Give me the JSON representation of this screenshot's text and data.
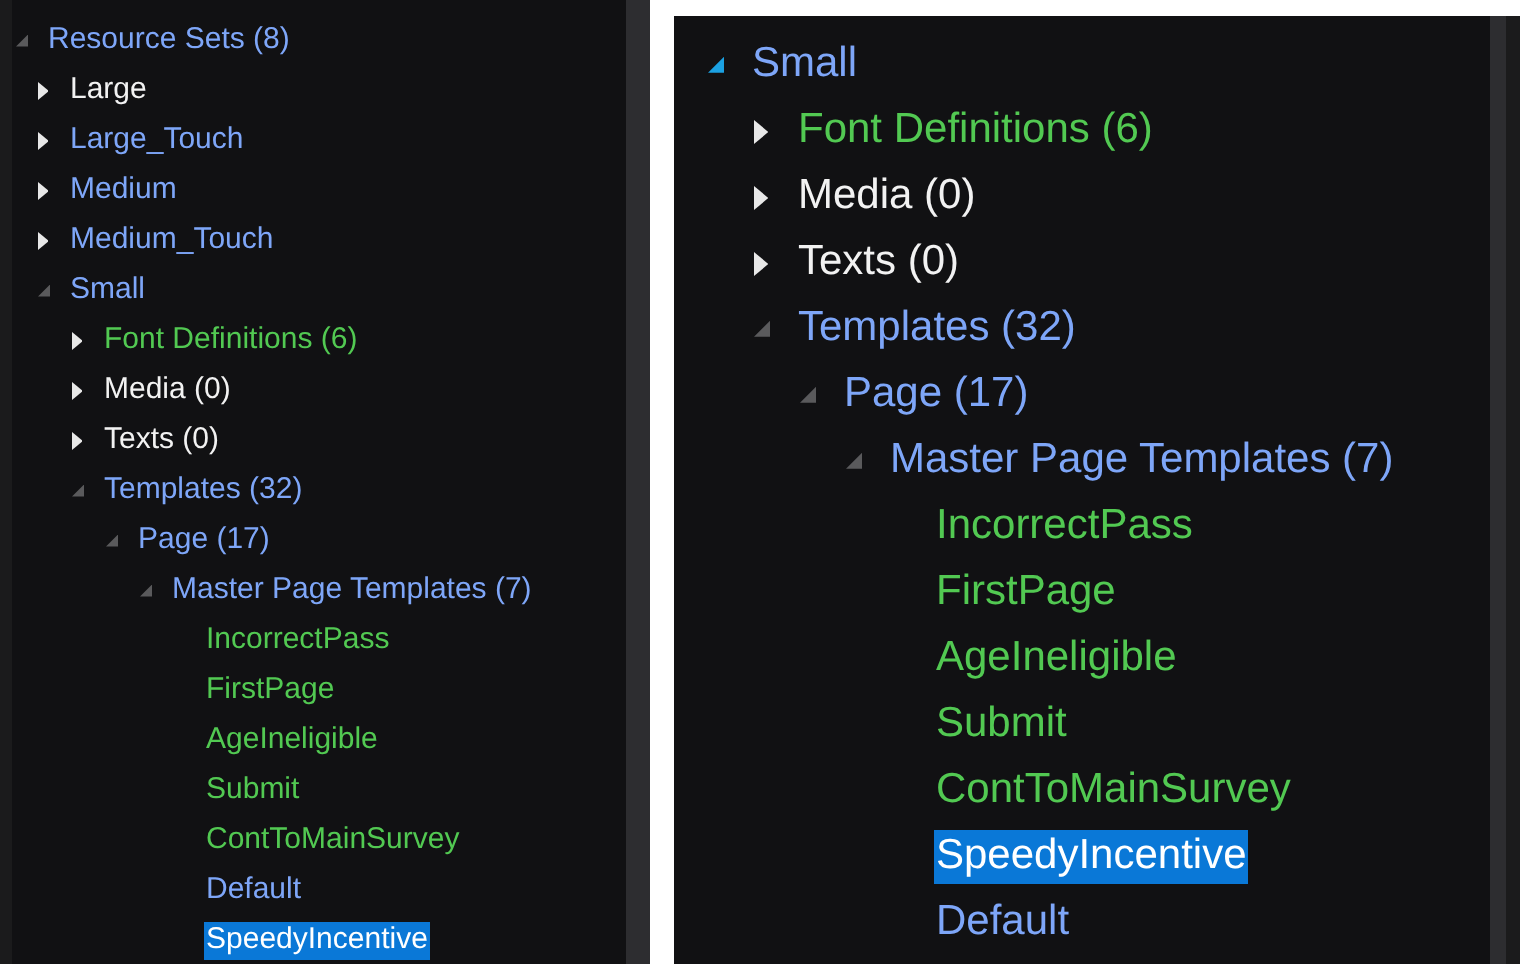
{
  "panels": [
    {
      "nodes": [
        {
          "label": "Resource Sets (8)",
          "color": "#7ea6f8",
          "expanded": true,
          "selected": false,
          "children": [
            {
              "label": "Large",
              "color": "#f2f2f2",
              "expanded": false,
              "selected": false
            },
            {
              "label": "Large_Touch",
              "color": "#7ea6f8",
              "expanded": false,
              "selected": false
            },
            {
              "label": "Medium",
              "color": "#7ea6f8",
              "expanded": false,
              "selected": false
            },
            {
              "label": "Medium_Touch",
              "color": "#7ea6f8",
              "expanded": false,
              "selected": false
            },
            {
              "label": "Small",
              "color": "#7ea6f8",
              "expanded": true,
              "selected": false,
              "children": [
                {
                  "label": "Font Definitions (6)",
                  "color": "#52c952",
                  "expanded": false,
                  "selected": false
                },
                {
                  "label": "Media (0)",
                  "color": "#f2f2f2",
                  "expanded": false,
                  "selected": false
                },
                {
                  "label": "Texts (0)",
                  "color": "#f2f2f2",
                  "expanded": false,
                  "selected": false
                },
                {
                  "label": "Templates (32)",
                  "color": "#7ea6f8",
                  "expanded": true,
                  "selected": false,
                  "children": [
                    {
                      "label": "Page (17)",
                      "color": "#7ea6f8",
                      "expanded": true,
                      "selected": false,
                      "children": [
                        {
                          "label": "Master Page Templates (7)",
                          "color": "#7ea6f8",
                          "expanded": true,
                          "selected": false,
                          "children": [
                            {
                              "label": "IncorrectPass",
                              "color": "#52c952",
                              "selected": false
                            },
                            {
                              "label": "FirstPage",
                              "color": "#52c952",
                              "selected": false
                            },
                            {
                              "label": "AgeIneligible",
                              "color": "#52c952",
                              "selected": false
                            },
                            {
                              "label": "Submit",
                              "color": "#52c952",
                              "selected": false
                            },
                            {
                              "label": "ContToMainSurvey",
                              "color": "#52c952",
                              "selected": false
                            },
                            {
                              "label": "Default",
                              "color": "#7ea6f8",
                              "selected": false
                            },
                            {
                              "label": "SpeedyIncentive",
                              "selected": true
                            }
                          ]
                        }
                      ]
                    }
                  ]
                }
              ]
            }
          ]
        }
      ]
    },
    {
      "nodes": [
        {
          "label": "Small",
          "color": "#7ea6f8",
          "expanded": true,
          "hovered": true,
          "selected": false,
          "children": [
            {
              "label": "Font Definitions (6)",
              "color": "#52c952",
              "expanded": false,
              "selected": false
            },
            {
              "label": "Media (0)",
              "color": "#f2f2f2",
              "expanded": false,
              "selected": false
            },
            {
              "label": "Texts (0)",
              "color": "#f2f2f2",
              "expanded": false,
              "selected": false
            },
            {
              "label": "Templates (32)",
              "color": "#7ea6f8",
              "expanded": true,
              "selected": false,
              "children": [
                {
                  "label": "Page (17)",
                  "color": "#7ea6f8",
                  "expanded": true,
                  "selected": false,
                  "children": [
                    {
                      "label": "Master Page Templates (7)",
                      "color": "#7ea6f8",
                      "expanded": true,
                      "selected": false,
                      "children": [
                        {
                          "label": "IncorrectPass",
                          "color": "#52c952",
                          "selected": false
                        },
                        {
                          "label": "FirstPage",
                          "color": "#52c952",
                          "selected": false
                        },
                        {
                          "label": "AgeIneligible",
                          "color": "#52c952",
                          "selected": false
                        },
                        {
                          "label": "Submit",
                          "color": "#52c952",
                          "selected": false
                        },
                        {
                          "label": "ContToMainSurvey",
                          "color": "#52c952",
                          "selected": false
                        },
                        {
                          "label": "SpeedyIncentive",
                          "selected": true
                        },
                        {
                          "label": "Default",
                          "color": "#7ea6f8",
                          "selected": false
                        }
                      ]
                    }
                  ]
                }
              ]
            }
          ]
        }
      ]
    }
  ]
}
